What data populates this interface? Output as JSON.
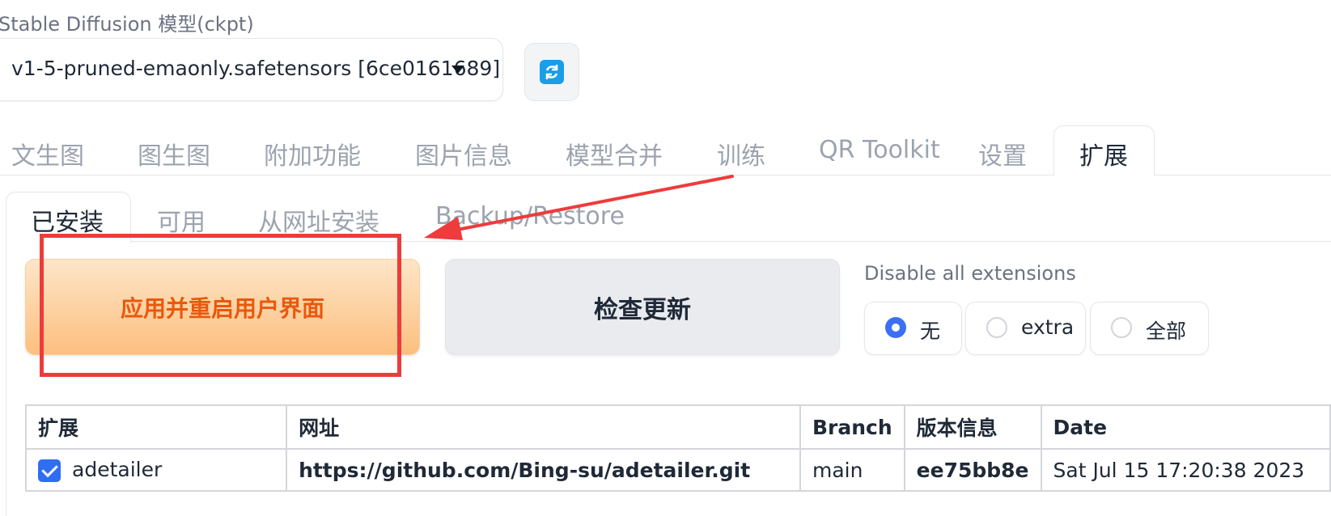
{
  "model": {
    "label": "Stable Diffusion 模型(ckpt)",
    "value": "v1-5-pruned-emaonly.safetensors [6ce0161689]",
    "refresh_icon": "refresh-icon"
  },
  "top_tabs": [
    "文生图",
    "图生图",
    "附加功能",
    "图片信息",
    "模型合并",
    "训练",
    "QR Toolkit",
    "设置",
    "扩展"
  ],
  "active_top_tab": "扩展",
  "sub_tabs": [
    "已安装",
    "可用",
    "从网址安装",
    "Backup/Restore"
  ],
  "active_sub_tab": "已安装",
  "buttons": {
    "apply": "应用并重启用户界面",
    "check": "检查更新"
  },
  "disable": {
    "label": "Disable all extensions",
    "options": [
      "无",
      "extra",
      "全部"
    ],
    "selected": "无"
  },
  "table": {
    "headers": [
      "扩展",
      "网址",
      "Branch",
      "版本信息",
      "Date"
    ],
    "rows": [
      {
        "checked": true,
        "name": "adetailer",
        "url": "https://github.com/Bing-su/adetailer.git",
        "branch": "main",
        "version": "ee75bb8e",
        "date": "Sat Jul 15 17:20:38 2023"
      }
    ]
  },
  "colors": {
    "accent": "#3b6ff5",
    "apply_text": "#ea580c",
    "annotation": "#ee3b3b",
    "refresh_icon_bg": "#1a9ee8"
  }
}
